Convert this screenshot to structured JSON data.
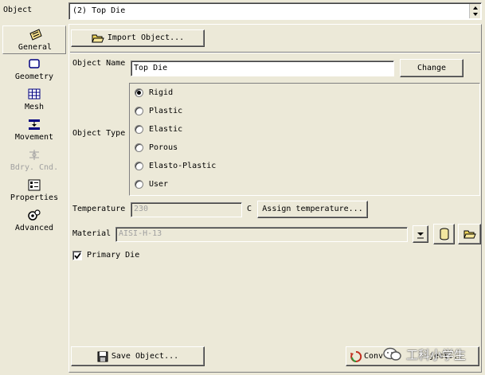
{
  "header": {
    "object_label": "Object",
    "object_selected": "(2) Top Die"
  },
  "sidebar": {
    "items": [
      {
        "label": "General",
        "icon": "general-icon",
        "active": true
      },
      {
        "label": "Geometry",
        "icon": "geometry-icon"
      },
      {
        "label": "Mesh",
        "icon": "mesh-icon"
      },
      {
        "label": "Movement",
        "icon": "movement-icon"
      },
      {
        "label": "Bdry. Cnd.",
        "icon": "boundary-condition-icon",
        "disabled": true
      },
      {
        "label": "Properties",
        "icon": "properties-icon"
      },
      {
        "label": "Advanced",
        "icon": "advanced-icon"
      }
    ]
  },
  "general": {
    "import_label": "Import Object...",
    "object_name_label": "Object Name",
    "object_name_value": "Top Die",
    "change_label": "Change",
    "object_type_label": "Object Type",
    "object_types": [
      "Rigid",
      "Plastic",
      "Elastic",
      "Porous",
      "Elasto-Plastic",
      "User"
    ],
    "selected_type": "Rigid",
    "temperature_label": "Temperature",
    "temperature_value": "230",
    "temperature_unit": "C",
    "assign_temperature_label": "Assign temperature...",
    "material_label": "Material",
    "material_value": "AISI-H-13",
    "primary_die_label": "Primary Die",
    "primary_die_checked": true,
    "save_label": "Save Object...",
    "convert_label": "Conv",
    "convert_label_tail": "ject..."
  },
  "watermark": "工科小学生"
}
